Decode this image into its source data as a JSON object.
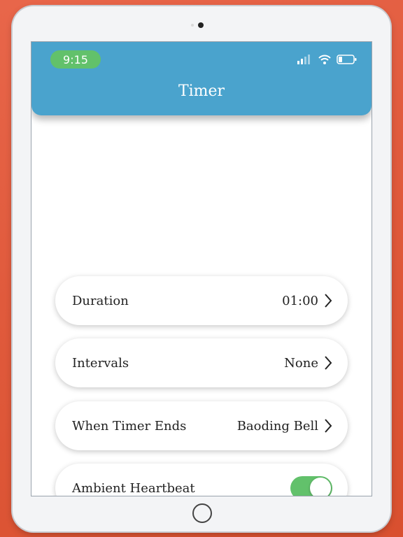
{
  "status_bar": {
    "time": "9:15"
  },
  "header": {
    "title": "Timer"
  },
  "settings": {
    "duration": {
      "label": "Duration",
      "value": "01:00"
    },
    "intervals": {
      "label": "Intervals",
      "value": "None"
    },
    "when_timer_ends": {
      "label": "When Timer Ends",
      "value": "Baoding Bell"
    },
    "ambient_heartbeat": {
      "label": "Ambient Heartbeat",
      "enabled": true
    }
  },
  "colors": {
    "header": "#4aa3cd",
    "accent_green": "#62c16b",
    "background": "#e05a3c"
  },
  "icons": [
    "signal-icon",
    "wifi-icon",
    "battery-icon",
    "chevron-right-icon"
  ]
}
